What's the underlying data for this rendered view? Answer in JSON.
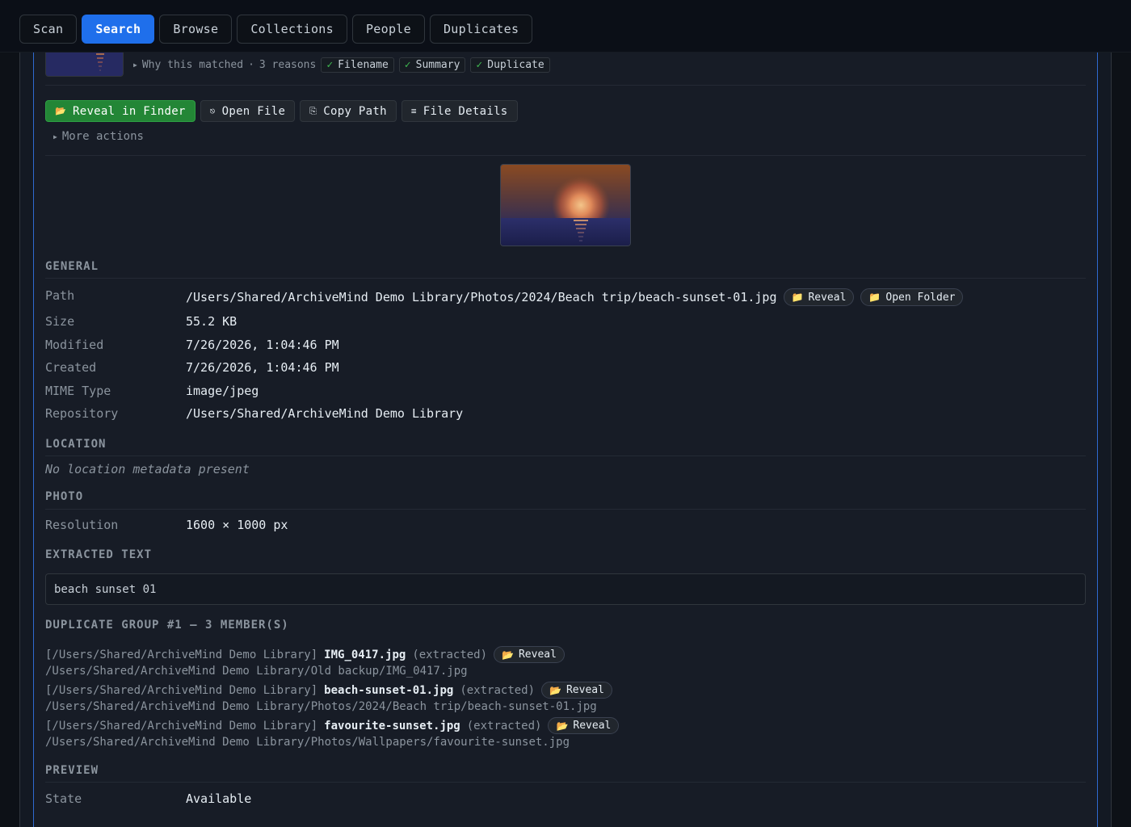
{
  "nav": {
    "tabs": [
      {
        "label": "Scan",
        "active": false
      },
      {
        "label": "Search",
        "active": true
      },
      {
        "label": "Browse",
        "active": false
      },
      {
        "label": "Collections",
        "active": false
      },
      {
        "label": "People",
        "active": false
      },
      {
        "label": "Duplicates",
        "active": false
      }
    ]
  },
  "match": {
    "why_label": "Why this matched",
    "dot": "·",
    "reasons_count": "3 reasons",
    "check": "✓",
    "reasons": [
      "Filename",
      "Summary",
      "Duplicate"
    ]
  },
  "actions": {
    "reveal_icon": "📂",
    "reveal": "Reveal in Finder",
    "open_icon": "⎋",
    "open": "Open File",
    "copy_icon": "⎘",
    "copy": "Copy Path",
    "details_icon": "≡",
    "details": "File Details",
    "more": "More actions"
  },
  "general": {
    "heading": "GENERAL",
    "path_label": "Path",
    "path": "/Users/Shared/ArchiveMind Demo Library/Photos/2024/Beach trip/beach-sunset-01.jpg",
    "folder_icon": "📁",
    "reveal_btn": "Reveal",
    "open_folder_btn": "Open Folder",
    "size_label": "Size",
    "size": "55.2 KB",
    "modified_label": "Modified",
    "modified": "7/26/2026, 1:04:46 PM",
    "created_label": "Created",
    "created": "7/26/2026, 1:04:46 PM",
    "mime_label": "MIME Type",
    "mime": "image/jpeg",
    "repo_label": "Repository",
    "repo": "/Users/Shared/ArchiveMind Demo Library"
  },
  "location": {
    "heading": "LOCATION",
    "empty": "No location metadata present"
  },
  "photo": {
    "heading": "PHOTO",
    "resolution_label": "Resolution",
    "resolution": "1600 × 1000 px"
  },
  "extracted": {
    "heading": "EXTRACTED TEXT",
    "text": "beach sunset 01"
  },
  "duplicates": {
    "heading": "DUPLICATE GROUP #1 — 3 MEMBER(S)",
    "reveal_icon": "📂",
    "reveal": "Reveal",
    "members": [
      {
        "repo": "[/Users/Shared/ArchiveMind Demo Library]",
        "name": "IMG_0417.jpg",
        "status": "(extracted)",
        "path": "/Users/Shared/ArchiveMind Demo Library/Old backup/IMG_0417.jpg"
      },
      {
        "repo": "[/Users/Shared/ArchiveMind Demo Library]",
        "name": "beach-sunset-01.jpg",
        "status": "(extracted)",
        "path": "/Users/Shared/ArchiveMind Demo Library/Photos/2024/Beach trip/beach-sunset-01.jpg"
      },
      {
        "repo": "[/Users/Shared/ArchiveMind Demo Library]",
        "name": "favourite-sunset.jpg",
        "status": "(extracted)",
        "path": "/Users/Shared/ArchiveMind Demo Library/Photos/Wallpapers/favourite-sunset.jpg"
      }
    ]
  },
  "preview": {
    "heading": "PREVIEW",
    "state_label": "State",
    "state": "Available"
  }
}
